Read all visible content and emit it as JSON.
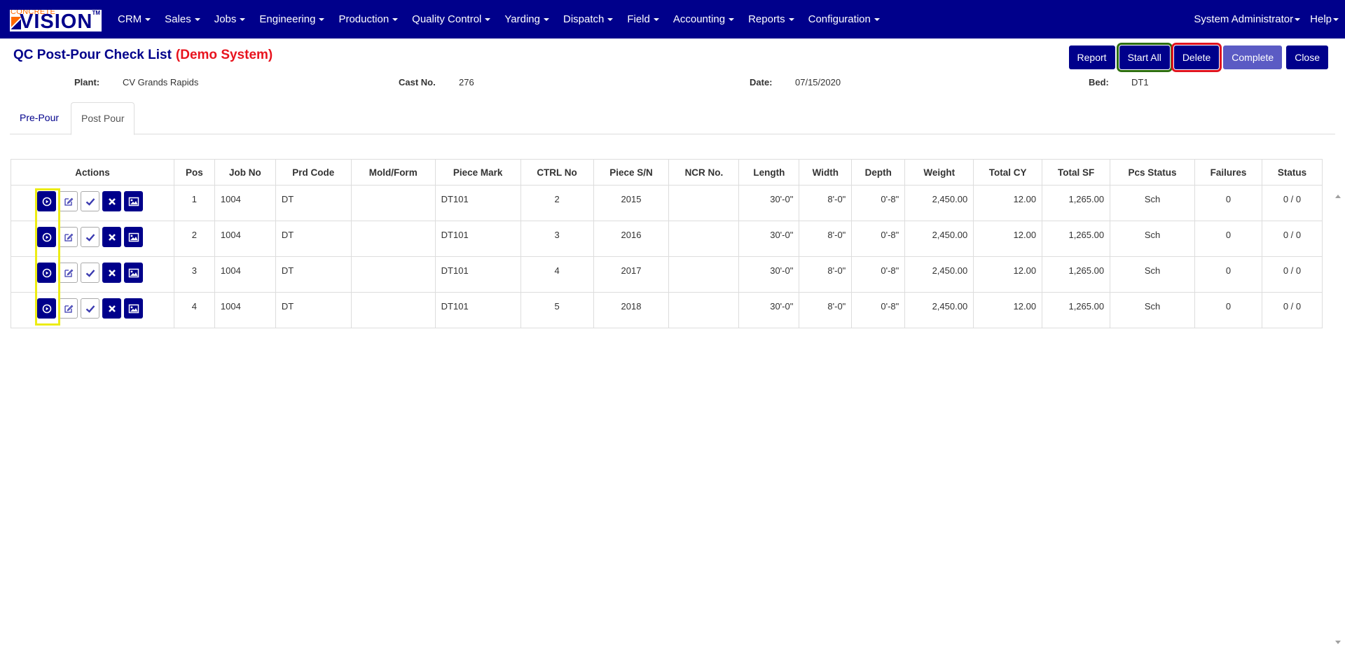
{
  "app": {
    "logo_small": "CONCRETE",
    "logo_big": "VISION",
    "logo_tm": "TM"
  },
  "nav": {
    "items": [
      "CRM",
      "Sales",
      "Jobs",
      "Engineering",
      "Production",
      "Quality Control",
      "Yarding",
      "Dispatch",
      "Field",
      "Accounting",
      "Reports",
      "Configuration"
    ],
    "user": "System Administrator",
    "help": "Help"
  },
  "header": {
    "title": "QC Post-Pour Check List",
    "demo": "(Demo System)"
  },
  "buttons": {
    "report": "Report",
    "start_all": "Start All",
    "delete": "Delete",
    "complete": "Complete",
    "close": "Close"
  },
  "info": {
    "plant_label": "Plant:",
    "plant_value": "CV Grands Rapids",
    "cast_label": "Cast No.",
    "cast_value": "276",
    "date_label": "Date:",
    "date_value": "07/15/2020",
    "bed_label": "Bed:",
    "bed_value": "DT1"
  },
  "tabs": {
    "pre_pour": "Pre-Pour",
    "post_pour": "Post Pour"
  },
  "table": {
    "columns": [
      "Actions",
      "Pos",
      "Job No",
      "Prd Code",
      "Mold/Form",
      "Piece Mark",
      "CTRL No",
      "Piece S/N",
      "NCR No.",
      "Length",
      "Width",
      "Depth",
      "Weight",
      "Total CY",
      "Total SF",
      "Pcs Status",
      "Failures",
      "Status"
    ],
    "rows": [
      {
        "pos": "1",
        "job": "1004",
        "prd": "DT",
        "mold": "",
        "mark": "DT101",
        "ctrl": "2",
        "sn": "2015",
        "ncr": "",
        "length": "30'-0\"",
        "width": "8'-0\"",
        "depth": "0'-8\"",
        "weight": "2,450.00",
        "cy": "12.00",
        "sf": "1,265.00",
        "pcs_status": "Sch",
        "failures": "0",
        "status": "0 / 0"
      },
      {
        "pos": "2",
        "job": "1004",
        "prd": "DT",
        "mold": "",
        "mark": "DT101",
        "ctrl": "3",
        "sn": "2016",
        "ncr": "",
        "length": "30'-0\"",
        "width": "8'-0\"",
        "depth": "0'-8\"",
        "weight": "2,450.00",
        "cy": "12.00",
        "sf": "1,265.00",
        "pcs_status": "Sch",
        "failures": "0",
        "status": "0 / 0"
      },
      {
        "pos": "3",
        "job": "1004",
        "prd": "DT",
        "mold": "",
        "mark": "DT101",
        "ctrl": "4",
        "sn": "2017",
        "ncr": "",
        "length": "30'-0\"",
        "width": "8'-0\"",
        "depth": "0'-8\"",
        "weight": "2,450.00",
        "cy": "12.00",
        "sf": "1,265.00",
        "pcs_status": "Sch",
        "failures": "0",
        "status": "0 / 0"
      },
      {
        "pos": "4",
        "job": "1004",
        "prd": "DT",
        "mold": "",
        "mark": "DT101",
        "ctrl": "5",
        "sn": "2018",
        "ncr": "",
        "length": "30'-0\"",
        "width": "8'-0\"",
        "depth": "0'-8\"",
        "weight": "2,450.00",
        "cy": "12.00",
        "sf": "1,265.00",
        "pcs_status": "Sch",
        "failures": "0",
        "status": "0 / 0"
      }
    ]
  },
  "icons": {
    "row_actions": [
      "play-circle-icon",
      "edit-icon",
      "check-icon",
      "times-icon",
      "image-icon"
    ]
  },
  "colors": {
    "nav_bg": "#00008b",
    "primary": "#00008b",
    "complete_btn": "#5b5bc4",
    "demo_text": "#e8141e",
    "highlight_green": "#2d6e10",
    "highlight_red": "#e0131f",
    "highlight_yellow": "#ecec14"
  }
}
